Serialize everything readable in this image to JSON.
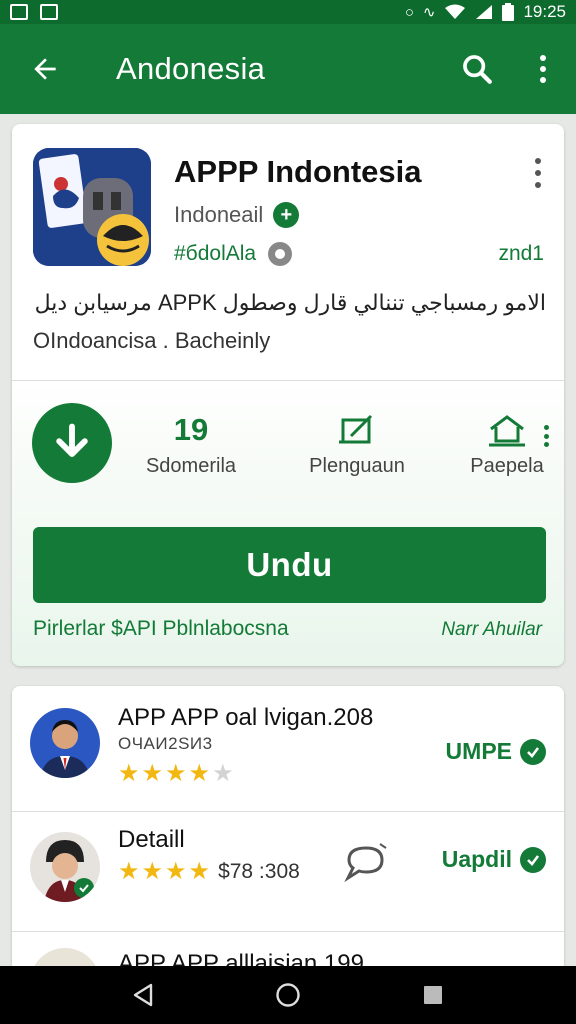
{
  "status_bar": {
    "time": "19:25"
  },
  "app_bar": {
    "title": "Andonesia"
  },
  "app": {
    "title": "APPP Indontesia",
    "developer": "Indoneail",
    "tag": "#бdolAla",
    "version": "znd1",
    "description_line1": "الامو رمسباجي تننالي قارل وصطول APPK مرسيابن ديل",
    "description_line2": "OIndoancisa . Bacheinly"
  },
  "stats": [
    {
      "value": "19",
      "label": "Sdomerila"
    },
    {
      "value": "",
      "label": "Plenguaun"
    },
    {
      "value": "",
      "label": "Paepela"
    }
  ],
  "install_button": "Undu",
  "notes": {
    "left": "Pirlerlar $API Pblnlabocsna",
    "right": "Narr Ahuilar"
  },
  "list": [
    {
      "title": "APP APP oal lvigan.208",
      "subtitle": "OЧАИ2SИ3",
      "rating": 4,
      "action": "UMPE"
    },
    {
      "title": "Detaill",
      "rating": 4,
      "price": "$78 :308",
      "action": "Uapdil"
    },
    {
      "title": "APP APP alllaisian.199"
    }
  ],
  "colors": {
    "primary": "#137a37",
    "status_bar": "#0d6b2e",
    "star": "#f3b712"
  }
}
